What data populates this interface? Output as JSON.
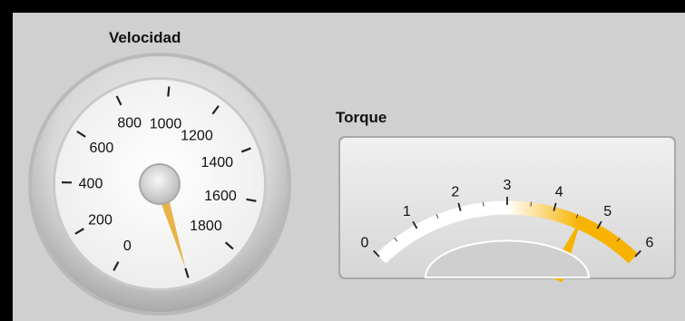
{
  "velocidad": {
    "label": "Velocidad",
    "min": 0,
    "max": 2000,
    "value": 2000,
    "scale_labels": [
      "0",
      "200",
      "400",
      "600",
      "800",
      "1000",
      "1200",
      "1400",
      "1600",
      "1800"
    ],
    "needle_color": "#e8b44a"
  },
  "torque": {
    "label": "Torque",
    "min": 0,
    "max": 6,
    "value": 4.6,
    "scale_labels": [
      "0",
      "1",
      "2",
      "3",
      "4",
      "5",
      "6"
    ],
    "arc_fill_color": "#f7b300",
    "needle_color": "#f7b300"
  }
}
